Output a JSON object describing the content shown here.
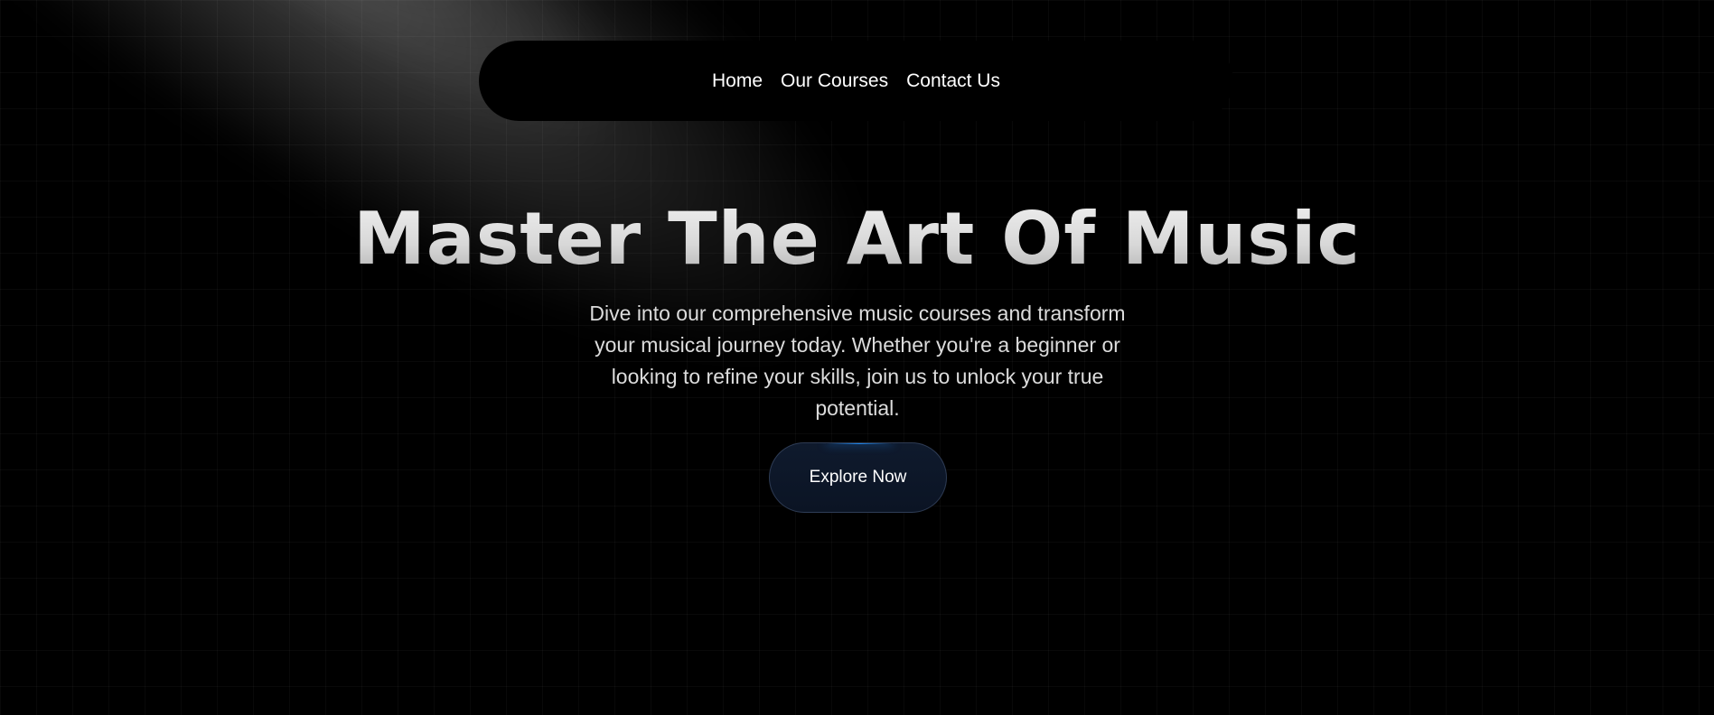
{
  "nav": {
    "items": [
      {
        "label": "Home"
      },
      {
        "label": "Our Courses"
      },
      {
        "label": "Contact Us"
      }
    ]
  },
  "hero": {
    "title": "Master The Art Of Music",
    "subtitle": "Dive into our comprehensive music courses and transform your musical journey today. Whether you're a beginner or looking to refine your skills, join us to unlock your true potential.",
    "cta_label": "Explore Now"
  },
  "colors": {
    "background": "#000000",
    "nav_background": "#000000",
    "button_background": "#0f1a2d",
    "button_glow": "#1e90ff",
    "text": "#ffffff"
  }
}
